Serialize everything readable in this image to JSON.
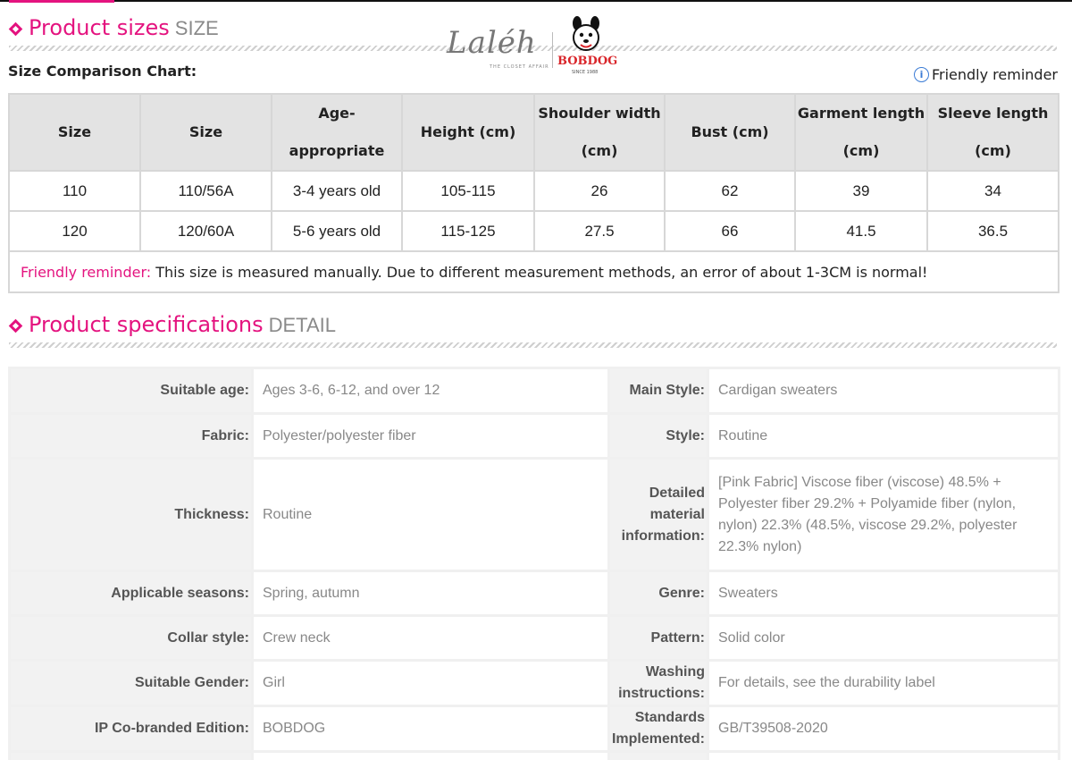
{
  "sections": {
    "sizes": {
      "title": "Product sizes",
      "sub": "SIZE"
    },
    "specs": {
      "title": "Product specifications",
      "sub": "DETAIL"
    }
  },
  "chart_label": "Size Comparison Chart:",
  "friendly_reminder_link": "Friendly reminder",
  "logo": {
    "laleh": "Laléh",
    "laleh_sub": "THE CLOSET AFFAIR",
    "bobdog": "BOBDOG",
    "bobdog_since": "SINCE 1988"
  },
  "size_table": {
    "headers": [
      {
        "line1": "Size",
        "line2": ""
      },
      {
        "line1": "Size",
        "line2": ""
      },
      {
        "line1": "Age-appropriate",
        "line2": ""
      },
      {
        "line1": "Height (cm)",
        "line2": ""
      },
      {
        "line1": "Shoulder width",
        "line2": "(cm)"
      },
      {
        "line1": "Bust (cm)",
        "line2": ""
      },
      {
        "line1": "Garment length",
        "line2": "(cm)"
      },
      {
        "line1": "Sleeve length",
        "line2": "(cm)"
      }
    ],
    "rows": [
      [
        "110",
        "110/56A",
        "3-4 years old",
        "105-115",
        "26",
        "62",
        "39",
        "34"
      ],
      [
        "120",
        "120/60A",
        "5-6 years old",
        "115-125",
        "27.5",
        "66",
        "41.5",
        "36.5"
      ]
    ],
    "note_label": "Friendly reminder:",
    "note_text": " This size is measured manually. Due to different measurement methods, an error of about 1-3CM is normal!"
  },
  "spec_table": [
    [
      {
        "k": "Suitable age:",
        "v": "Ages 3-6, 6-12, and over 12"
      },
      {
        "k": "Main Style:",
        "v": "Cardigan sweaters"
      }
    ],
    [
      {
        "k": "Fabric:",
        "v": "Polyester/polyester fiber"
      },
      {
        "k": "Style:",
        "v": "Routine"
      }
    ],
    [
      {
        "k": "Thickness:",
        "v": "Routine"
      },
      {
        "k": "Detailed material information:",
        "v": "[Pink Fabric] Viscose fiber (viscose) 48.5% + Polyester fiber 29.2% + Polyamide fiber (nylon, nylon) 22.3% (48.5%, viscose 29.2%, polyester 22.3% nylon)"
      }
    ],
    [
      {
        "k": "Applicable seasons:",
        "v": "Spring, autumn"
      },
      {
        "k": "Genre:",
        "v": "Sweaters"
      }
    ],
    [
      {
        "k": "Collar style:",
        "v": "Crew neck"
      },
      {
        "k": "Pattern:",
        "v": "Solid color"
      }
    ],
    [
      {
        "k": "Suitable Gender:",
        "v": "Girl"
      },
      {
        "k": "Washing instructions:",
        "v": "For details, see the durability label"
      }
    ],
    [
      {
        "k": "IP Co-branded Edition:",
        "v": "BOBDOG"
      },
      {
        "k": "Standards Implemented:",
        "v": "GB/T39508-2020"
      }
    ],
    [
      {
        "k": "",
        "v": ""
      },
      {
        "k": "",
        "v": ""
      }
    ]
  ],
  "colors": {
    "accent": "#e4137f",
    "info": "#3a7bd5",
    "brand_red": "#d9252a"
  },
  "icons": [
    "diamond-bullet-icon",
    "info-icon",
    "bobdog-mascot-icon"
  ]
}
